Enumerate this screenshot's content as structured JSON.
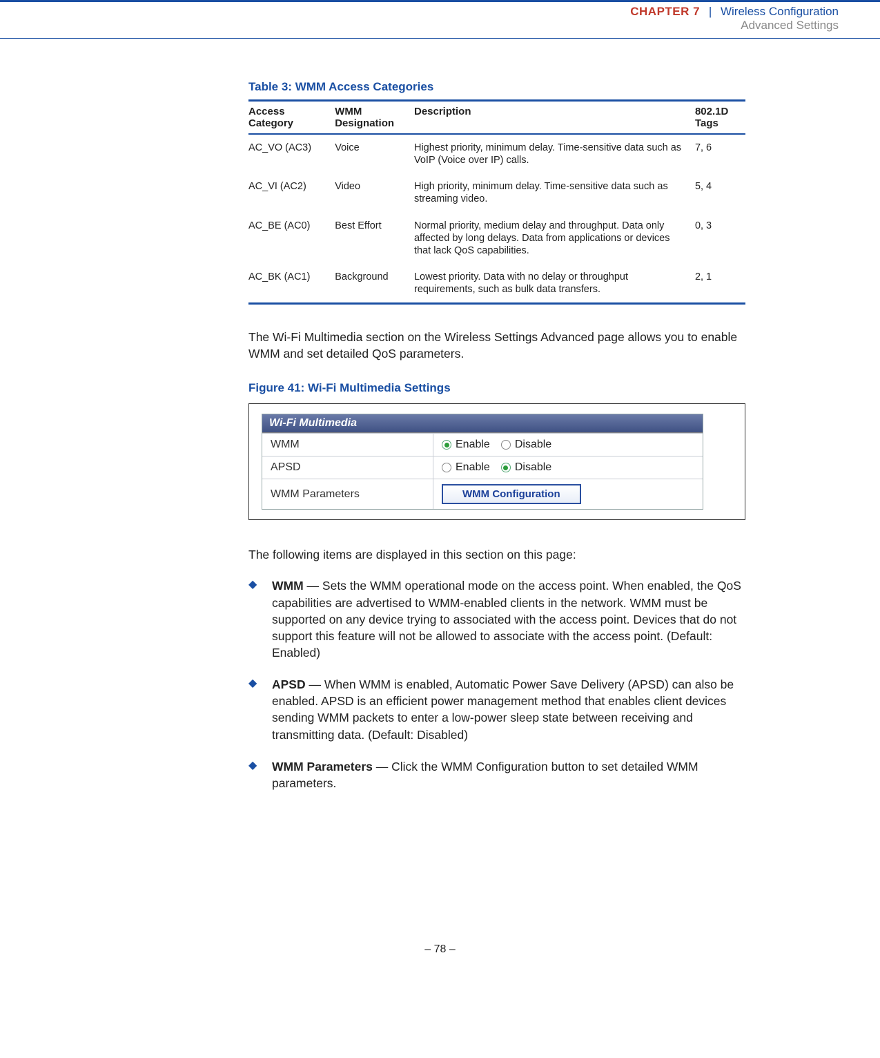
{
  "header": {
    "chapter_label": "CHAPTER 7",
    "separator": "|",
    "section_title": "Wireless Configuration",
    "subsection_title": "Advanced Settings"
  },
  "table": {
    "title": "Table 3: WMM Access Categories",
    "columns": {
      "access_category": "Access Category",
      "wmm_designation": "WMM Designation",
      "description": "Description",
      "tags": "802.1D Tags"
    },
    "rows": [
      {
        "access_category": "AC_VO (AC3)",
        "wmm_designation": "Voice",
        "description": "Highest priority, minimum delay. Time-sensitive data such as VoIP (Voice over IP) calls.",
        "tags": "7, 6"
      },
      {
        "access_category": "AC_VI (AC2)",
        "wmm_designation": "Video",
        "description": "High priority, minimum delay. Time-sensitive data such as streaming video.",
        "tags": "5, 4"
      },
      {
        "access_category": "AC_BE (AC0)",
        "wmm_designation": "Best Effort",
        "description": "Normal priority, medium delay and throughput. Data only affected by long delays. Data from applications or devices that lack QoS capabilities.",
        "tags": "0, 3"
      },
      {
        "access_category": "AC_BK (AC1)",
        "wmm_designation": "Background",
        "description": "Lowest priority. Data with no delay or throughput requirements, such as bulk data transfers.",
        "tags": "2, 1"
      }
    ]
  },
  "body_paragraph": "The Wi-Fi Multimedia section on the Wireless Settings Advanced page allows you to enable WMM and set detailed QoS parameters.",
  "figure": {
    "title": "Figure 41:  Wi-Fi Multimedia Settings",
    "panel_header": "Wi-Fi Multimedia",
    "rows": {
      "wmm": {
        "label": "WMM",
        "enable": "Enable",
        "disable": "Disable",
        "selected": "enable"
      },
      "apsd": {
        "label": "APSD",
        "enable": "Enable",
        "disable": "Disable",
        "selected": "disable"
      },
      "params": {
        "label": "WMM Parameters",
        "button": "WMM Configuration"
      }
    }
  },
  "items_intro": "The following items are displayed in this section on this page:",
  "items": [
    {
      "term": "WMM",
      "text": " — Sets the WMM operational mode on the access point. When enabled, the QoS capabilities are advertised to WMM-enabled clients in the network. WMM must be supported on any device trying to associated with the access point. Devices that do not support this feature will not be allowed to associate with the access point. (Default: Enabled)"
    },
    {
      "term": "APSD",
      "text": " — When WMM is enabled, Automatic Power Save Delivery (APSD) can also be enabled. APSD is an efficient power management method that enables client devices sending WMM packets to enter a low-power sleep state between receiving and transmitting data. (Default: Disabled)"
    },
    {
      "term": "WMM Parameters",
      "text": " — Click the WMM Configuration button to set detailed WMM parameters."
    }
  ],
  "footer": {
    "page_number": "–  78  –"
  }
}
